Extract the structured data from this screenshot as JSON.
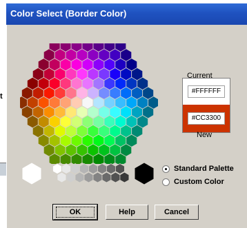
{
  "window": {
    "title": "Color Select (Border Color)"
  },
  "background": {
    "partial_label": "t"
  },
  "preview": {
    "current_label": "Current",
    "new_label": "New",
    "current_value": "#FFFFFF",
    "new_value": "#CC3300",
    "current_color": "#ffffff",
    "new_color": "#cc3300"
  },
  "palette_mode": {
    "standard_label": "Standard Palette",
    "custom_label": "Custom Color",
    "selected": "standard"
  },
  "buttons": {
    "ok": "OK",
    "help": "Help",
    "cancel": "Cancel"
  },
  "icons": {
    "color_wheel": "hexagon-color-palette",
    "gray_scale": "gray-swatch-row"
  }
}
